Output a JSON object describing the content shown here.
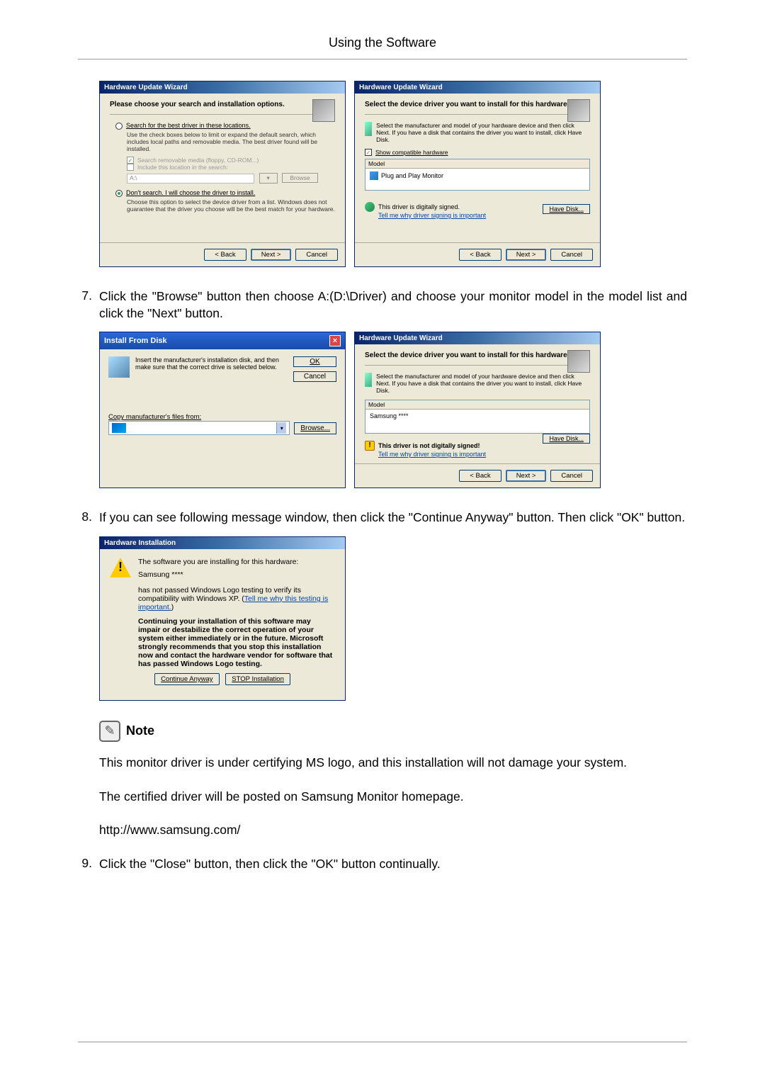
{
  "page_header": "Using the Software",
  "step7": {
    "num": "7.",
    "text": "Click the \"Browse\" button then choose A:(D:\\Driver) and choose your monitor model in the model list and click the \"Next\" button."
  },
  "step8": {
    "num": "8.",
    "text": "If you can see following message window, then click the \"Continue Anyway\" button. Then click \"OK\" button."
  },
  "step9": {
    "num": "9.",
    "text": "Click the \"Close\" button, then click the \"OK\" button continually."
  },
  "wiz_a": {
    "title": "Hardware Update Wizard",
    "heading": "Please choose your search and installation options.",
    "r1": "Search for the best driver in these locations.",
    "r1_sub": "Use the check boxes below to limit or expand the default search, which includes local paths and removable media. The best driver found will be installed.",
    "chk1": "Search removable media (floppy, CD-ROM...)",
    "chk2": "Include this location in the search:",
    "path": "A:\\",
    "browse": "Browse",
    "r2": "Don't search. I will choose the driver to install.",
    "r2_sub": "Choose this option to select the device driver from a list. Windows does not guarantee that the driver you choose will be the best match for your hardware.",
    "back": "< Back",
    "next": "Next >",
    "cancel": "Cancel"
  },
  "wiz_b": {
    "title": "Hardware Update Wizard",
    "heading": "Select the device driver you want to install for this hardware.",
    "tip": "Select the manufacturer and model of your hardware device and then click Next. If you have a disk that contains the driver you want to install, click Have Disk.",
    "show_compat": "Show compatible hardware",
    "model_head": "Model",
    "model_item": "Plug and Play Monitor",
    "signed": "This driver is digitally signed.",
    "tell_me": "Tell me why driver signing is important",
    "have_disk": "Have Disk...",
    "back": "< Back",
    "next": "Next >",
    "cancel": "Cancel"
  },
  "dlg_install": {
    "title": "Install From Disk",
    "msg": "Insert the manufacturer's installation disk, and then make sure that the correct drive is selected below.",
    "ok": "OK",
    "cancel": "Cancel",
    "copy_label": "Copy manufacturer's files from:",
    "browse": "Browse..."
  },
  "wiz_c": {
    "title": "Hardware Update Wizard",
    "heading": "Select the device driver you want to install for this hardware.",
    "tip": "Select the manufacturer and model of your hardware device and then click Next. If you have a disk that contains the driver you want to install, click Have Disk.",
    "model_head": "Model",
    "model_item": "Samsung ****",
    "warn": "This driver is not digitally signed!",
    "tell_me": "Tell me why driver signing is important",
    "have_disk": "Have Disk...",
    "back": "< Back",
    "next": "Next >",
    "cancel": "Cancel"
  },
  "hw_install": {
    "title": "Hardware Installation",
    "line1": "The software you are installing for this hardware:",
    "line2": "Samsung ****",
    "line3a": "has not passed Windows Logo testing to verify its compatibility with Windows XP. (",
    "line3_link": "Tell me why this testing is important.",
    "line3b": ")",
    "bold": "Continuing your installation of this software may impair or destabilize the correct operation of your system either immediately or in the future. Microsoft strongly recommends that you stop this installation now and contact the hardware vendor for software that has passed Windows Logo testing.",
    "cont": "Continue Anyway",
    "stop": "STOP Installation"
  },
  "note_label": "Note",
  "note_p1": "This monitor driver is under certifying MS logo, and this installation will not damage your system.",
  "note_p2": "The certified driver will be posted on Samsung Monitor homepage.",
  "note_url": "http://www.samsung.com/"
}
